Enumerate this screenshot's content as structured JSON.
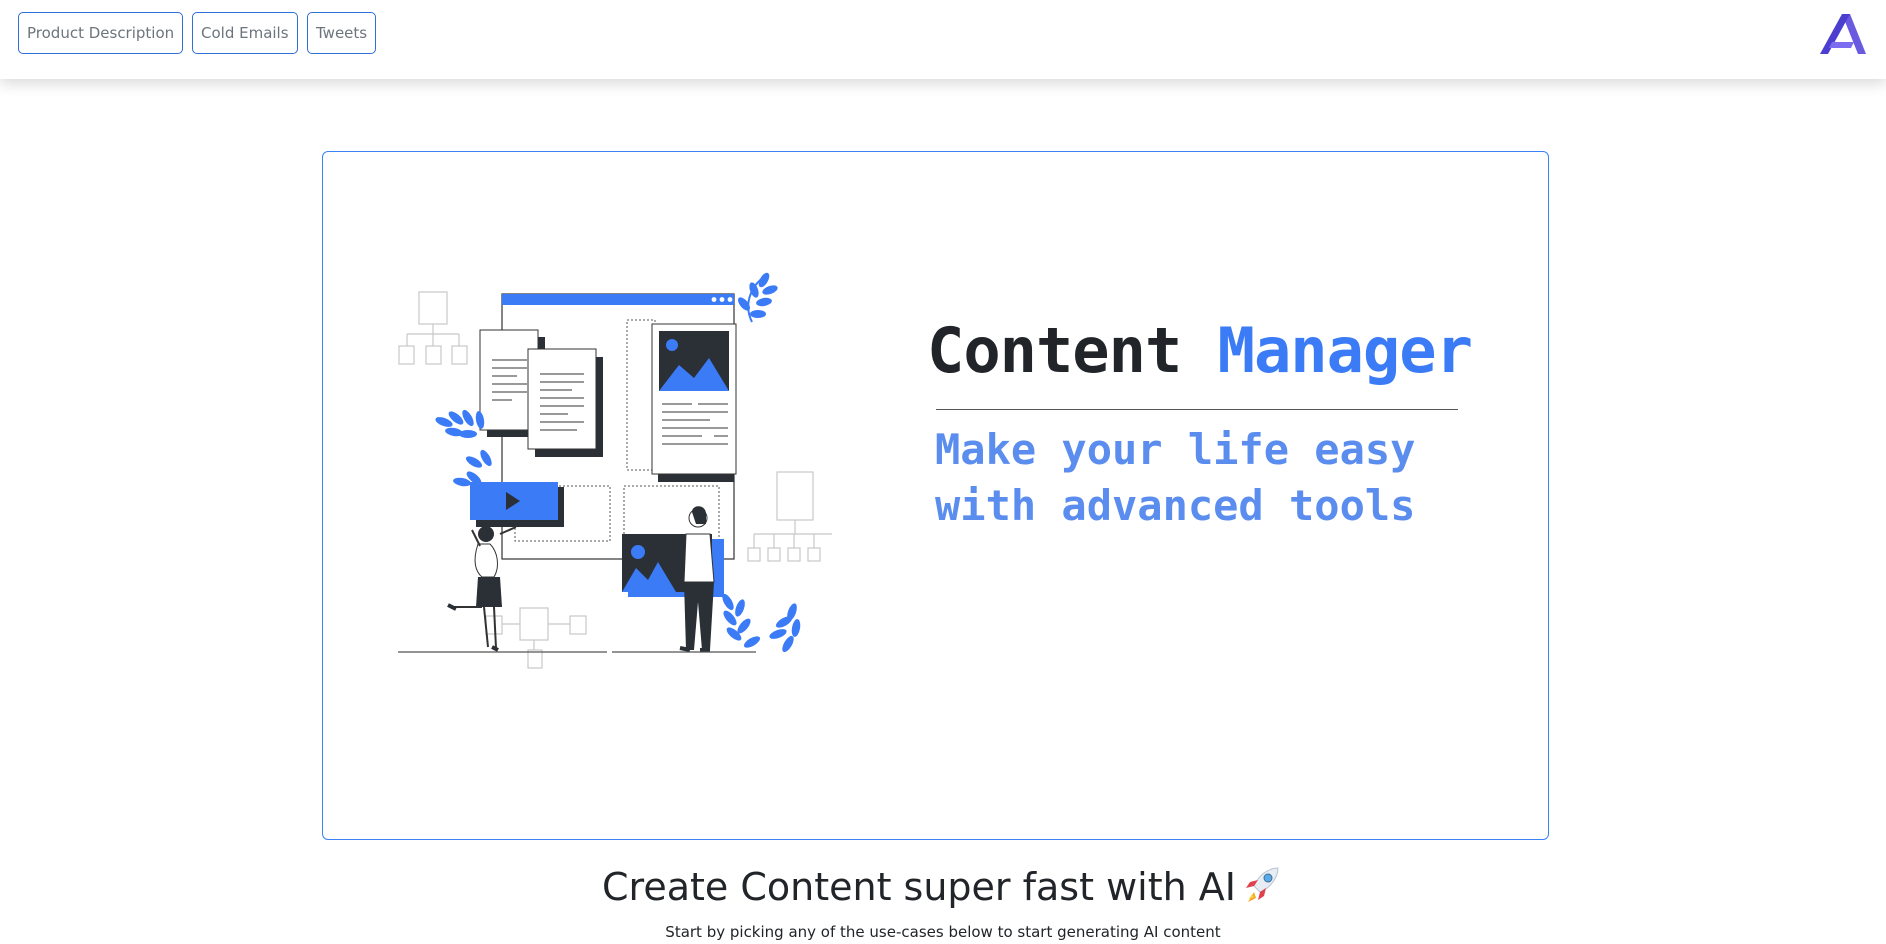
{
  "nav": {
    "items": [
      {
        "label": "Product Description"
      },
      {
        "label": "Cold Emails"
      },
      {
        "label": "Tweets"
      }
    ],
    "logo_icon": "brand-logo-icon"
  },
  "hero": {
    "title_part1": "Content",
    "title_part2": "Manager",
    "subtitle": "Make your life easy with advanced tools",
    "illustration_icon": "content-management-illustration"
  },
  "main": {
    "heading": "Create Content super fast with AI",
    "heading_icon": "rocket-icon",
    "subheading": "Start by picking any of the use-cases below to start generating AI content"
  },
  "colors": {
    "accent": "#3b7bf6",
    "subtitle": "#5b8def",
    "border": "#2f6fd8",
    "logo": "#5b4bd6"
  }
}
